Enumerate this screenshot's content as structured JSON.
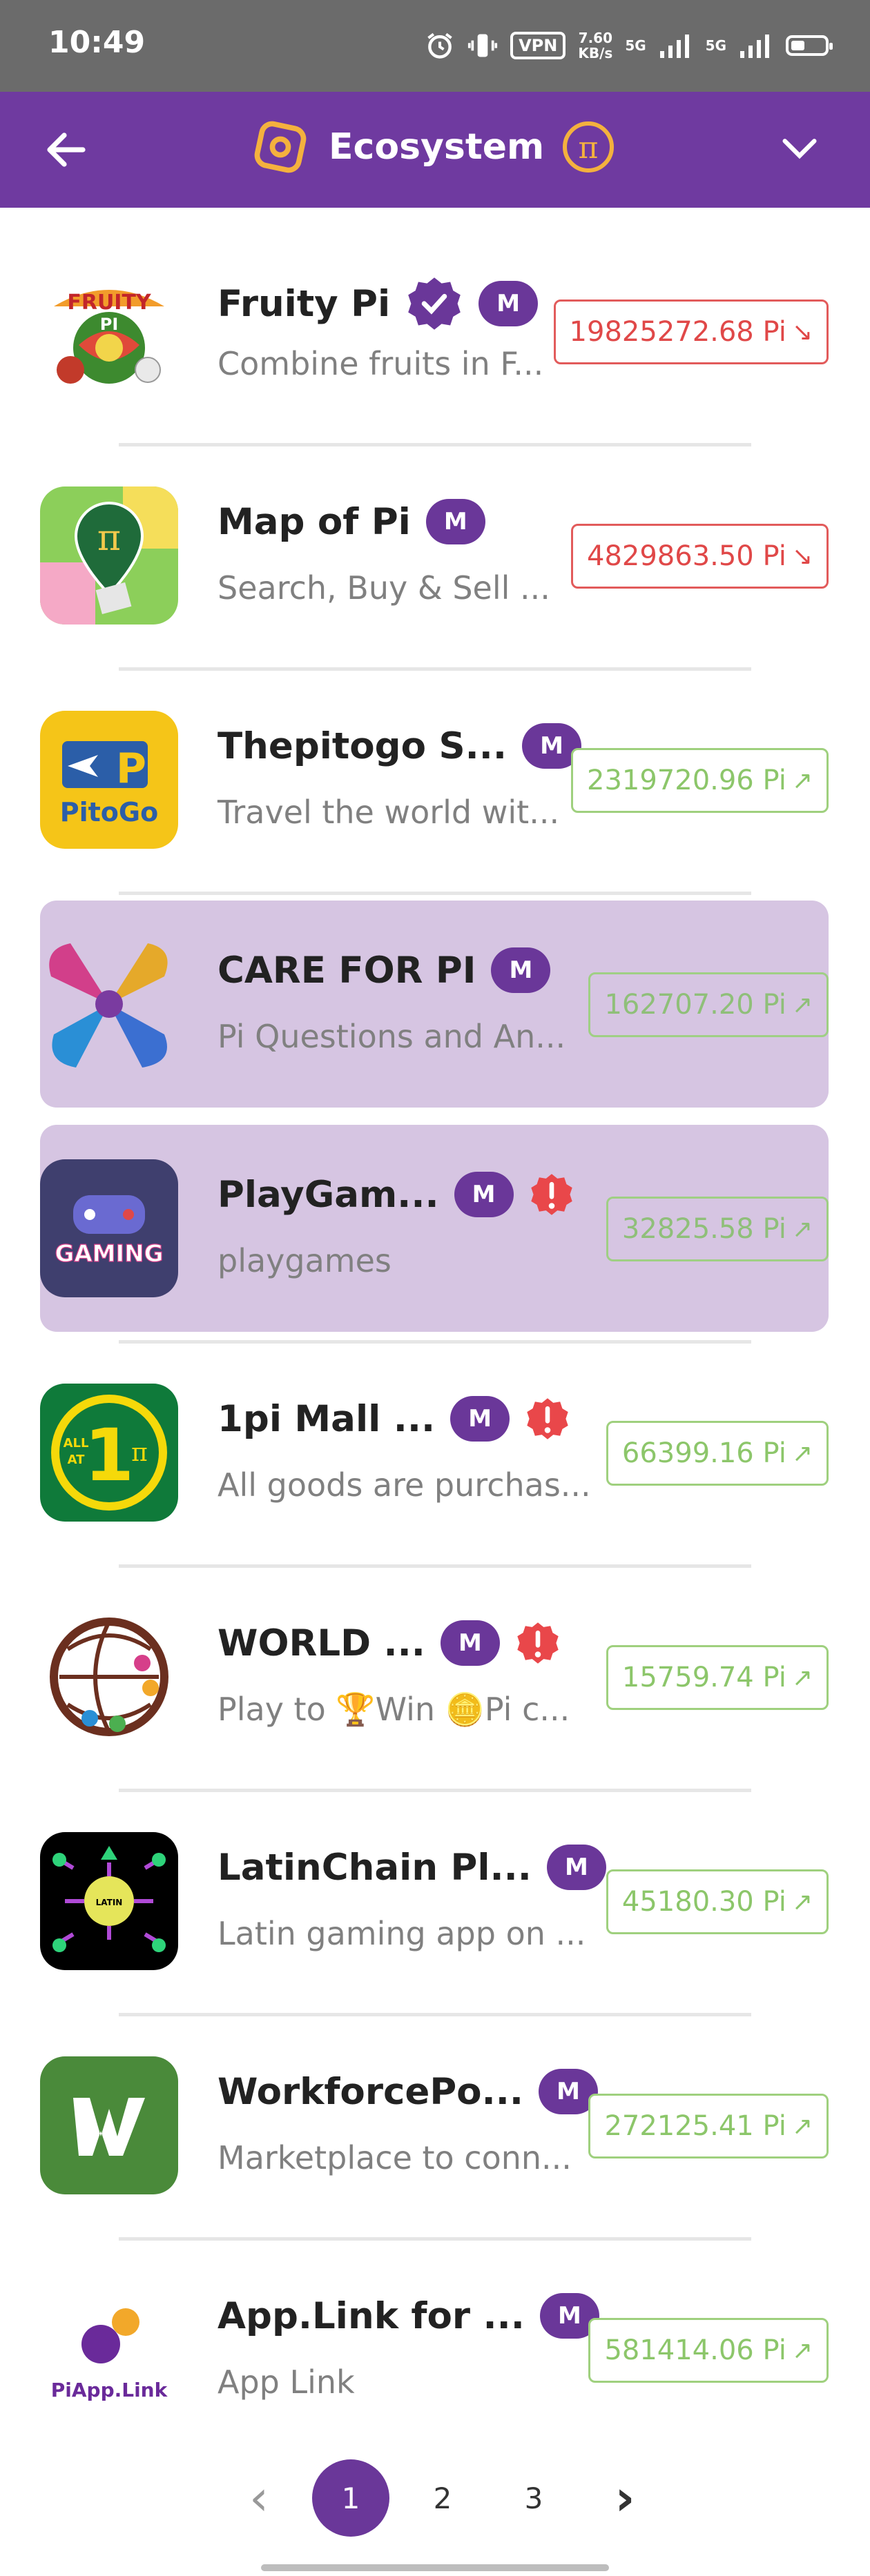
{
  "status_bar": {
    "time": "10:49",
    "vpn": "VPN",
    "speed_top": "7.60",
    "speed_bottom": "KB/s",
    "sig1": "5G",
    "sig2": "5G"
  },
  "header": {
    "title": "Ecosystem"
  },
  "colors": {
    "header_bg": "#6f3aa0",
    "badge_purple": "#6a3799",
    "price_down": "#e04848",
    "price_up": "#8cc66a",
    "highlight_row": "#d6c5e2"
  },
  "apps": [
    {
      "name": "Fruity Pi",
      "badge": "M",
      "verified": true,
      "warning": false,
      "desc": "Combine fruits in F...",
      "price": "19825272.68 Pi",
      "trend": "down",
      "icon": "fruity-pi-logo",
      "highlighted": false
    },
    {
      "name": "Map of Pi",
      "badge": "M",
      "verified": false,
      "warning": false,
      "desc": "Search, Buy & Sell ...",
      "price": "4829863.50 Pi",
      "trend": "down",
      "icon": "map-pin-pi-logo",
      "highlighted": false
    },
    {
      "name": "Thepitogo S...",
      "badge": "M",
      "verified": false,
      "warning": false,
      "desc": "Travel the world wit...",
      "price": "2319720.96 Pi",
      "trend": "up",
      "icon": "pitogo-logo",
      "highlighted": false
    },
    {
      "name": "CARE FOR PI",
      "badge": "M",
      "verified": false,
      "warning": false,
      "desc": "Pi Questions and An...",
      "price": "162707.20 Pi",
      "trend": "up",
      "icon": "hands-logo",
      "highlighted": true
    },
    {
      "name": "PlayGam...",
      "badge": "M",
      "verified": false,
      "warning": true,
      "desc": "playgames",
      "price": "32825.58 Pi",
      "trend": "up",
      "icon": "gaming-logo",
      "highlighted": true
    },
    {
      "name": "1pi Mall ...",
      "badge": "M",
      "verified": false,
      "warning": true,
      "desc": "All goods are purchas...",
      "price": "66399.16 Pi",
      "trend": "up",
      "icon": "1pi-mall-logo",
      "highlighted": false
    },
    {
      "name": "WORLD ...",
      "badge": "M",
      "verified": false,
      "warning": true,
      "desc": "Play to 🏆Win 🪙Pi c...",
      "price": "15759.74 Pi",
      "trend": "up",
      "icon": "world-globe-logo",
      "highlighted": false
    },
    {
      "name": "LatinChain Pl...",
      "badge": "M",
      "verified": false,
      "warning": false,
      "desc": "Latin gaming app on ...",
      "price": "45180.30 Pi",
      "trend": "up",
      "icon": "latinchain-logo",
      "highlighted": false
    },
    {
      "name": "WorkforcePo...",
      "badge": "M",
      "verified": false,
      "warning": false,
      "desc": "Marketplace to conn...",
      "price": "272125.41 Pi",
      "trend": "up",
      "icon": "workforce-w-logo",
      "highlighted": false
    },
    {
      "name": "App.Link for ...",
      "badge": "M",
      "verified": false,
      "warning": false,
      "desc": "App Link",
      "price": "581414.06 Pi",
      "trend": "up",
      "icon": "piapp-link-logo",
      "highlighted": false
    }
  ],
  "icon_texts": {
    "pitogo": "PitoGo",
    "gaming": "GAMING",
    "mall_num": "1",
    "mall_all": "ALL",
    "mall_at": "AT",
    "piapplink": "PiApp.Link"
  },
  "pagination": {
    "prev": "‹",
    "pages": [
      "1",
      "2",
      "3"
    ],
    "current": "1",
    "next": "›"
  }
}
